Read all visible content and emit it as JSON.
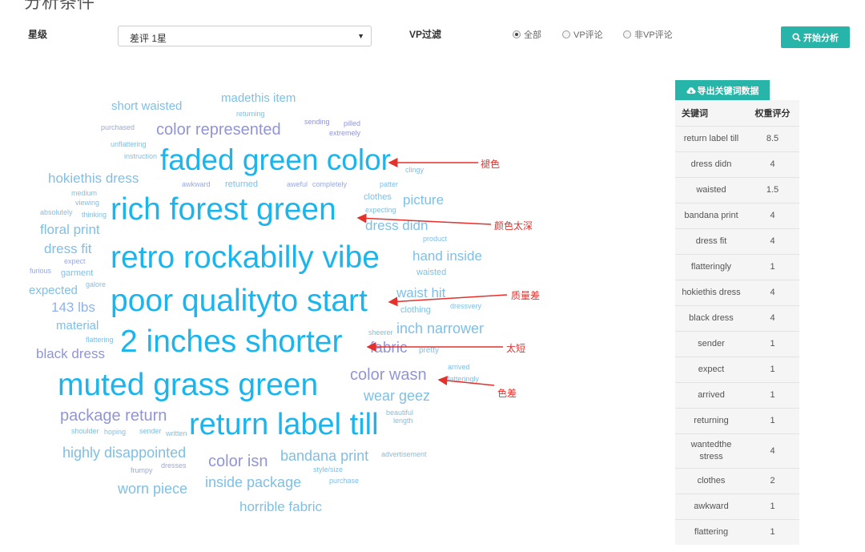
{
  "page": {
    "title": "分析条件"
  },
  "filters": {
    "star_label": "星级",
    "star_value": "差评 1星",
    "vp_label": "VP过滤",
    "vp_options": [
      {
        "label": "全部",
        "selected": true
      },
      {
        "label": "VP评论",
        "selected": false
      },
      {
        "label": "非VP评论",
        "selected": false
      }
    ],
    "analyze_button": "开始分析"
  },
  "wordcloud": {
    "words": [
      "short waisted",
      "madethis item",
      "returning",
      "purchased",
      "color represented",
      "sending",
      "pilled",
      "extremely",
      "unflattering",
      "instruction",
      "faded green color",
      "clingy",
      "hokiethis dress",
      "awkward",
      "returned",
      "aweful",
      "completely",
      "patter",
      "medium",
      "viewing",
      "clothes",
      "picture",
      "absolutely",
      "thinking",
      "rich forest green",
      "expecting",
      "floral print",
      "dress didn",
      "product",
      "dress fit",
      "expect",
      "retro rockabilly vibe",
      "hand inside",
      "furious",
      "garment",
      "waisted",
      "expected",
      "galore",
      "waist hit",
      "143 lbs",
      "poor qualityto start",
      "clothing",
      "dressvery",
      "material",
      "sheerer",
      "inch narrower",
      "flattering",
      "2 inches shorter",
      "fabric",
      "pretty",
      "black dress",
      "arrived",
      "muted grass green",
      "color wasn",
      "flatteringly",
      "wear geez",
      "package return",
      "beautiful",
      "length",
      "shoulder",
      "hoping",
      "sender",
      "written",
      "return label till",
      "highly disappointed",
      "frumpy",
      "dresses",
      "color isn",
      "bandana print",
      "advertisement",
      "style/size",
      "worn piece",
      "inside package",
      "purchase",
      "horrible fabric"
    ]
  },
  "annotations": [
    "褪色",
    "颜色太深",
    "质量差",
    "太短",
    "色差"
  ],
  "colors": {
    "accent": "#26b5a8",
    "annotation": "#e5302b",
    "cloud_primary": "#1bb5ee"
  },
  "keyword_panel": {
    "export_button": "导出关键词数据",
    "headers": [
      "关键词",
      "权重评分"
    ],
    "rows": [
      {
        "keyword": "return label till",
        "score": "8.5"
      },
      {
        "keyword": "dress didn",
        "score": "4"
      },
      {
        "keyword": "waisted",
        "score": "1.5"
      },
      {
        "keyword": "bandana print",
        "score": "4"
      },
      {
        "keyword": "dress fit",
        "score": "4"
      },
      {
        "keyword": "flatteringly",
        "score": "1"
      },
      {
        "keyword": "hokiethis dress",
        "score": "4"
      },
      {
        "keyword": "black dress",
        "score": "4"
      },
      {
        "keyword": "sender",
        "score": "1"
      },
      {
        "keyword": "expect",
        "score": "1"
      },
      {
        "keyword": "arrived",
        "score": "1"
      },
      {
        "keyword": "returning",
        "score": "1"
      },
      {
        "keyword": "wantedthe stress",
        "score": "4"
      },
      {
        "keyword": "clothes",
        "score": "2"
      },
      {
        "keyword": "awkward",
        "score": "1"
      },
      {
        "keyword": "flattering",
        "score": "1"
      }
    ]
  }
}
